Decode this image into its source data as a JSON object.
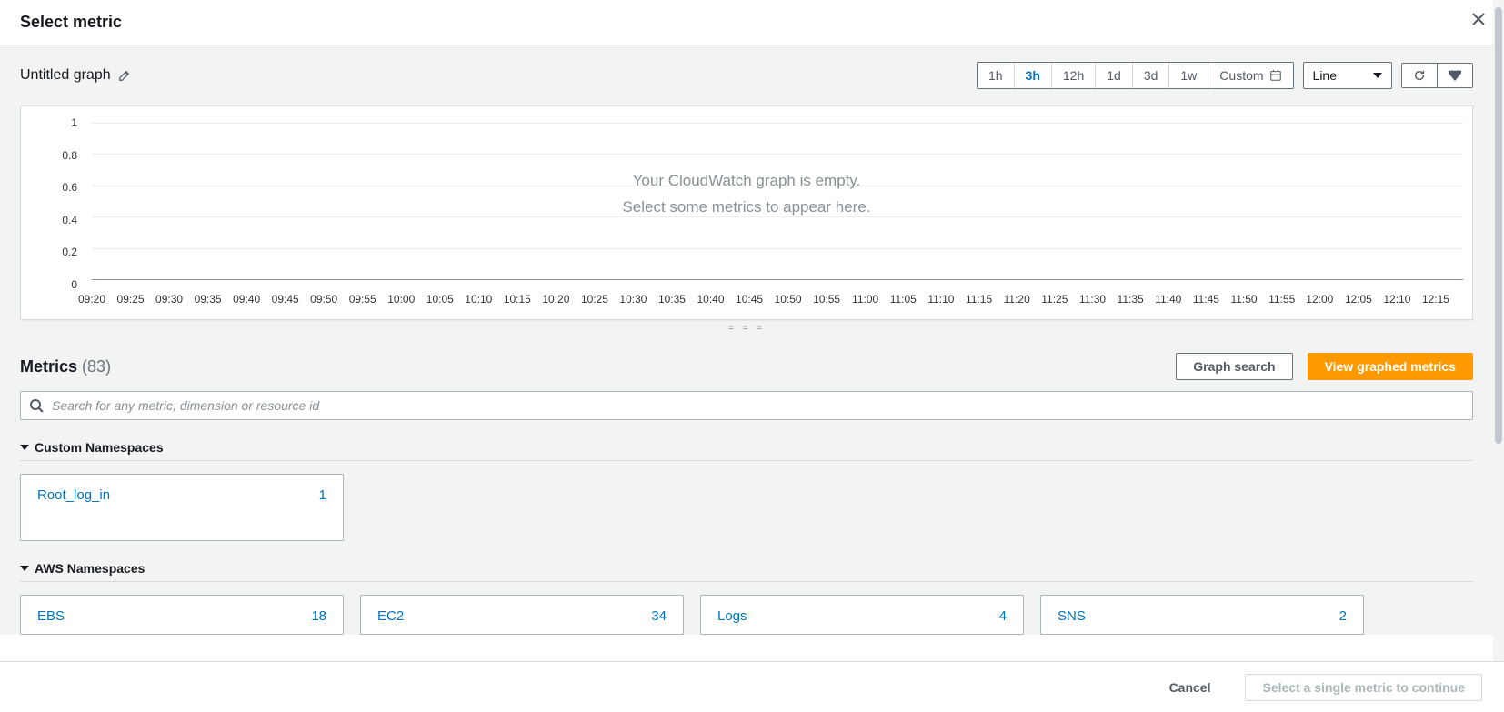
{
  "title": "Select metric",
  "graph": {
    "name": "Untitled graph",
    "chart_type": "Line",
    "empty_line1": "Your CloudWatch graph is empty.",
    "empty_line2": "Select some metrics to appear here."
  },
  "timeranges": {
    "h1": "1h",
    "h3": "3h",
    "h12": "12h",
    "d1": "1d",
    "d3": "3d",
    "w1": "1w",
    "custom": "Custom"
  },
  "chart_data": {
    "type": "line",
    "series": [],
    "title": "",
    "xlabel": "",
    "ylabel": "",
    "ylim": [
      0,
      1
    ],
    "yticks": [
      1,
      0.8,
      0.6,
      0.4,
      0.2,
      0
    ],
    "xticks": [
      "09:20",
      "09:25",
      "09:30",
      "09:35",
      "09:40",
      "09:45",
      "09:50",
      "09:55",
      "10:00",
      "10:05",
      "10:10",
      "10:15",
      "10:20",
      "10:25",
      "10:30",
      "10:35",
      "10:40",
      "10:45",
      "10:50",
      "10:55",
      "11:00",
      "11:05",
      "11:10",
      "11:15",
      "11:20",
      "11:25",
      "11:30",
      "11:35",
      "11:40",
      "11:45",
      "11:50",
      "11:55",
      "12:00",
      "12:05",
      "12:10",
      "12:15"
    ]
  },
  "metrics": {
    "heading": "Metrics",
    "count": "(83)",
    "graph_search": "Graph search",
    "view_graphed": "View graphed metrics",
    "search_placeholder": "Search for any metric, dimension or resource id",
    "custom_heading": "Custom Namespaces",
    "aws_heading": "AWS Namespaces",
    "custom_ns": [
      {
        "name": "Root_log_in",
        "count": "1"
      }
    ],
    "aws_ns": [
      {
        "name": "EBS",
        "count": "18"
      },
      {
        "name": "EC2",
        "count": "34"
      },
      {
        "name": "Logs",
        "count": "4"
      },
      {
        "name": "SNS",
        "count": "2"
      }
    ]
  },
  "footer": {
    "cancel": "Cancel",
    "continue": "Select a single metric to continue"
  },
  "drag_handle": "= = ="
}
